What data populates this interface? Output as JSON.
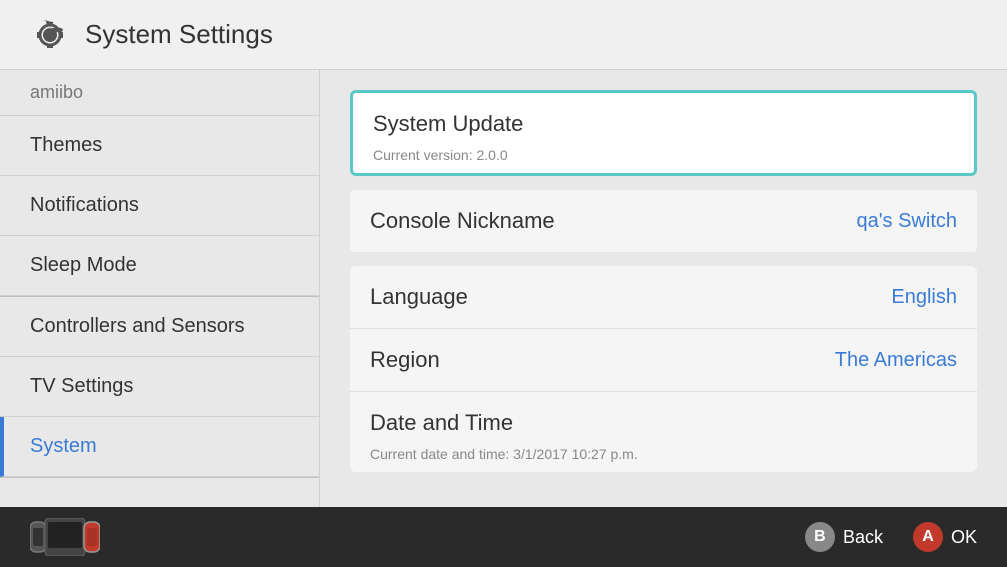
{
  "header": {
    "title": "System Settings",
    "icon": "gear"
  },
  "sidebar": {
    "items": [
      {
        "id": "amiibo",
        "label": "amiibo",
        "active": false,
        "muted": true
      },
      {
        "id": "themes",
        "label": "Themes",
        "active": false
      },
      {
        "id": "notifications",
        "label": "Notifications",
        "active": false
      },
      {
        "id": "sleep-mode",
        "label": "Sleep Mode",
        "active": false
      },
      {
        "id": "controllers-sensors",
        "label": "Controllers and Sensors",
        "active": false
      },
      {
        "id": "tv-settings",
        "label": "TV Settings",
        "active": false
      },
      {
        "id": "system",
        "label": "System",
        "active": true
      }
    ]
  },
  "content": {
    "system_update": {
      "label": "System Update",
      "subtitle": "Current version: 2.0.0"
    },
    "console_nickname": {
      "label": "Console Nickname",
      "value": "qa's Switch"
    },
    "language": {
      "label": "Language",
      "value": "English"
    },
    "region": {
      "label": "Region",
      "value": "The Americas"
    },
    "date_and_time": {
      "label": "Date and Time",
      "subtitle": "Current date and time: 3/1/2017 10:27 p.m."
    }
  },
  "bottom_bar": {
    "back_label": "Back",
    "ok_label": "OK",
    "back_btn": "B",
    "ok_btn": "A"
  }
}
